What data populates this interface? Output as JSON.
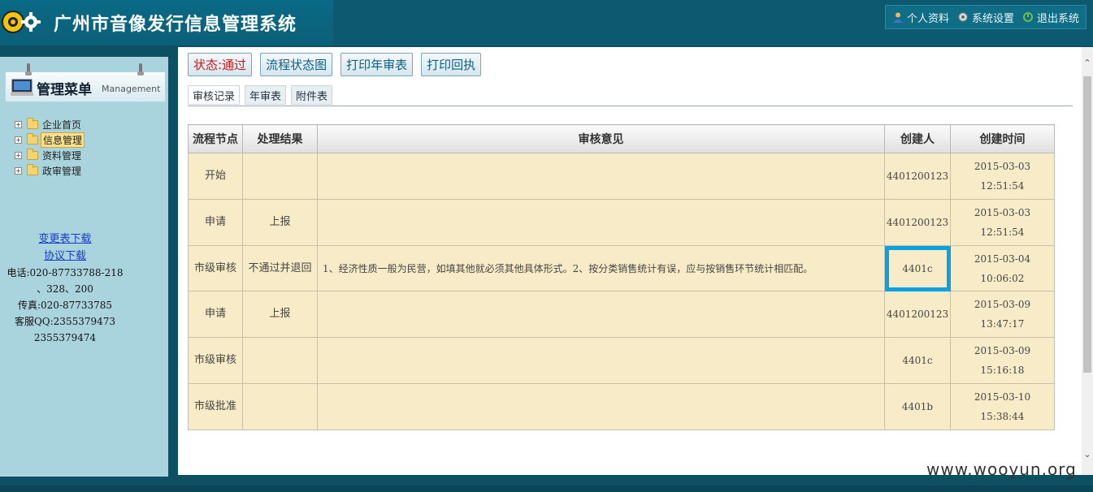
{
  "header": {
    "title": "广州市音像发行信息管理系统",
    "links": [
      {
        "label": "个人资料",
        "icon": "user-icon"
      },
      {
        "label": "系统设置",
        "icon": "gear-icon"
      },
      {
        "label": "退出系统",
        "icon": "exit-icon"
      }
    ]
  },
  "sidebar": {
    "menu_title": "管理菜单",
    "menu_subtitle": "Management",
    "items": [
      {
        "label": "企业首页",
        "active": false
      },
      {
        "label": "信息管理",
        "active": true
      },
      {
        "label": "资料管理",
        "active": false
      },
      {
        "label": "政审管理",
        "active": false
      }
    ],
    "contact": {
      "change_form_link": "变更表下载",
      "agreement_link": "协议下载",
      "phone_line1": "电话:020-87733788-218",
      "phone_line2": "、328、200",
      "fax": "传真:020-87733785",
      "qq_line1": "客服QQ:2355379473",
      "qq_line2": "2355379474"
    }
  },
  "toolbar": {
    "status": "状态:通过",
    "flow_chart": "流程状态图",
    "print_annual": "打印年审表",
    "print_receipt": "打印回执"
  },
  "tabs": [
    "审核记录",
    "年审表",
    "附件表"
  ],
  "table": {
    "headers": [
      "流程节点",
      "处理结果",
      "审核意见",
      "创建人",
      "创建时间"
    ],
    "rows": [
      {
        "node": "开始",
        "result": "",
        "opinion": "",
        "creator": "4401200123",
        "date": "2015-03-03",
        "time": "12:51:54"
      },
      {
        "node": "申请",
        "result": "上报",
        "opinion": "",
        "creator": "4401200123",
        "date": "2015-03-03",
        "time": "12:51:54"
      },
      {
        "node": "市级审核",
        "result": "不通过并退回",
        "opinion": "1、经济性质一般为民营，如填其他就必须其他具体形式。2、按分类销售统计有误，应与按销售环节统计相匹配。",
        "creator": "4401c",
        "date": "2015-03-04",
        "time": "10:06:02"
      },
      {
        "node": "申请",
        "result": "上报",
        "opinion": "",
        "creator": "4401200123",
        "date": "2015-03-09",
        "time": "13:47:17"
      },
      {
        "node": "市级审核",
        "result": "",
        "opinion": "",
        "creator": "4401c",
        "date": "2015-03-09",
        "time": "15:16:18"
      },
      {
        "node": "市级批准",
        "result": "",
        "opinion": "",
        "creator": "4401b",
        "date": "2015-03-10",
        "time": "15:38:44"
      }
    ]
  },
  "watermark": "www.wooyun.org"
}
